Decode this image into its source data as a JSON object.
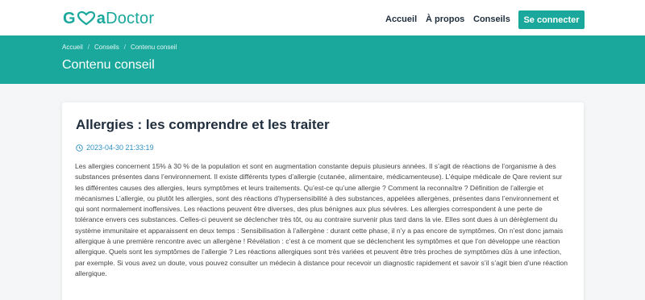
{
  "logo": {
    "part1": "G",
    "part2": "a",
    "part3": "Doctor"
  },
  "nav": {
    "accueil": "Accueil",
    "apropos": "À propos",
    "conseils": "Conseils",
    "login": "Se connecter"
  },
  "breadcrumb": {
    "home": "Accueil",
    "section": "Conseils",
    "current": "Contenu conseil"
  },
  "banner": {
    "title": "Contenu conseil"
  },
  "article": {
    "title": "Allergies : les comprendre et les traiter",
    "date": "2023-04-30 21:33:19",
    "body": "Les allergies concernent 15% à 30 % de la population et sont en augmentation constante depuis plusieurs années. Il s’agit de réactions de l’organisme à des substances présentes dans l’environnement. Il existe différents types d’allergie (cutanée, alimentaire, médicamenteuse). L’équipe médicale de Qare revient sur les différentes causes des allergies, leurs symptômes et leurs traitements. Qu’est-ce qu’une allergie ? Comment la reconnaître ? Définition de l’allergie et mécanismes L’allergie, ou plutôt les allergies, sont des réactions d’hypersensibilité à des substances, appelées allergènes, présentes dans l’environnement et qui sont normalement inoffensives. Les réactions peuvent être diverses, des plus bénignes aux plus sévères. Les allergies correspondent à une perte de tolérance envers ces substances. Celles-ci peuvent se déclencher très tôt, ou au contraire survenir plus tard dans la vie. Elles sont dues à un dérèglement du système immunitaire et apparaissent en deux temps : Sensibilisation à l’allergène : durant cette phase, il n’y a pas encore de symptômes. On n’est donc jamais allergique à une première rencontre avec un allergène ! Révélation : c’est à ce moment que se déclenchent les symptômes et que l’on développe une réaction allergique. Quels sont les symptômes de l’allergie ? Les réactions allergiques sont très variées et peuvent être très proches de symptômes dûs à une infection, par exemple. Si vous avez un doute, vous pouvez consulter un médecin à distance pour recevoir un diagnostic rapidement et savoir s’il s’agit bien d’une réaction allergique."
  },
  "colors": {
    "brand": "#19a89b",
    "date": "#2f8fc2",
    "heading": "#1f2d3d"
  },
  "icons": {
    "logo_heart": "heart-icon",
    "date": "clock-icon"
  }
}
